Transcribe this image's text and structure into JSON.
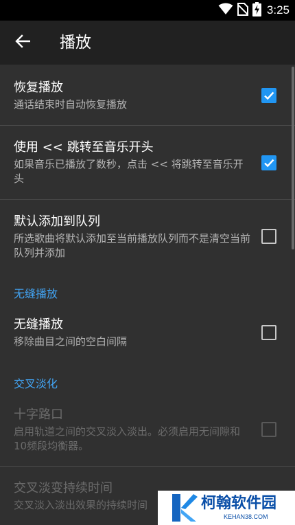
{
  "status_bar": {
    "time": "3:25"
  },
  "toolbar": {
    "title": "播放"
  },
  "prefs": {
    "resume": {
      "title": "恢复播放",
      "summary": "通话结束时自动恢复播放",
      "checked": true
    },
    "rewind": {
      "title": "使用 << 跳转至音乐开头",
      "summary": "如果音乐已播放了数秒，点击 << 将跳转至音乐开头",
      "checked": true
    },
    "queue": {
      "title": "默认添加到队列",
      "summary": "所选歌曲将默认添加至当前播放队列而不是清空当前队列并添加",
      "checked": false
    },
    "gapless_category": "无缝播放",
    "gapless": {
      "title": "无缝播放",
      "summary": "移除曲目之间的空白间隔",
      "checked": false
    },
    "crossfade_category": "交叉淡化",
    "crossfade": {
      "title": "十字路口",
      "summary": "启用轨道之间的交叉淡入淡出。必须启用无间隙和10频段均衡器。",
      "checked": false,
      "enabled": false
    },
    "crossfade_duration": {
      "title": "交叉淡变持续时间",
      "summary": "交叉淡入淡出效果的持续时间",
      "enabled": false
    }
  },
  "watermark": {
    "name": "柯翰软件园",
    "url": "KEHAN38.COM"
  },
  "colors": {
    "accent": "#2196f3",
    "category": "#42a5f5",
    "toolbar": "#212121",
    "background": "#303030"
  }
}
